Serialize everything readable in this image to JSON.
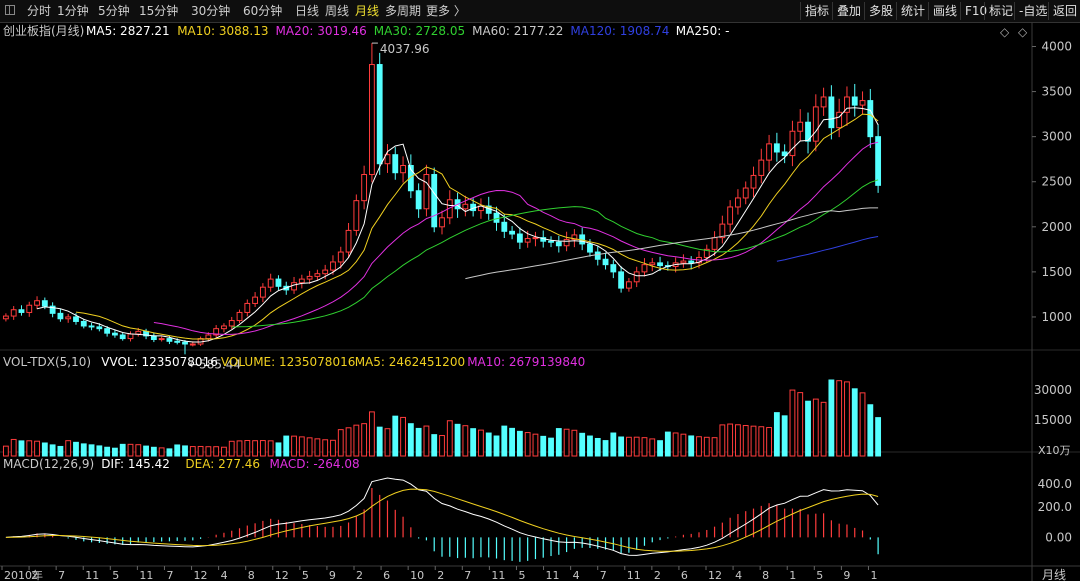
{
  "toolbar": {
    "periods": [
      "分时",
      "1分钟",
      "5分钟",
      "15分钟",
      "30分钟",
      "60分钟",
      "日线",
      "周线",
      "月线",
      "多周期",
      "更多 〉"
    ],
    "active_period": "月线",
    "right_buttons": [
      "指标",
      "叠加",
      "多股",
      "统计",
      "画线",
      "F10",
      "标记",
      "-自选",
      "返回"
    ]
  },
  "price_panel": {
    "title": "创业板指(月线)",
    "ma_items": [
      {
        "text": "MA5: 2827.21",
        "color": "#ffffff"
      },
      {
        "text": "MA10: 3088.13",
        "color": "#f0d020"
      },
      {
        "text": "MA20: 3019.46",
        "color": "#e030e0"
      },
      {
        "text": "MA30: 2728.05",
        "color": "#30d030"
      },
      {
        "text": "MA60: 2177.22",
        "color": "#c8c8c8"
      },
      {
        "text": "MA120: 1908.74",
        "color": "#3040e0"
      },
      {
        "text": "MA250: -",
        "color": "#ffffff"
      }
    ],
    "high_label": "4037.96",
    "low_label": "585.44",
    "yticks": [
      1000,
      1500,
      2000,
      2500,
      3000,
      3500,
      4000
    ]
  },
  "volume_panel": {
    "items": [
      {
        "text": "VOL-TDX(5,10)",
        "color": "#c8c8c8"
      },
      {
        "text": "VVOL: 1235078016",
        "color": "#ffffff"
      },
      {
        "text": "VOLUME: 1235078016",
        "color": "#f0d020"
      },
      {
        "text": "MA5: 2462451200",
        "color": "#f0d020"
      },
      {
        "text": "MA10: 2679139840",
        "color": "#e030e0"
      }
    ],
    "yticks": [
      "30000",
      "15000"
    ],
    "unit": "X10万"
  },
  "macd_panel": {
    "items": [
      {
        "text": "MACD(12,26,9)",
        "color": "#c8c8c8"
      },
      {
        "text": "DIF: 145.42",
        "color": "#ffffff"
      },
      {
        "text": "DEA: 277.46",
        "color": "#f0d020"
      },
      {
        "text": "MACD: -264.08",
        "color": "#e030e0"
      }
    ],
    "yticks": [
      "400.0",
      "200.0",
      "0.00"
    ]
  },
  "xaxis": {
    "labels": [
      "2010年",
      "2",
      "7",
      "11",
      "5",
      "11",
      "7",
      "12",
      "4",
      "8",
      "12",
      "5",
      "9",
      "2",
      "6",
      "10",
      "2",
      "7",
      "11",
      "5",
      "11",
      "4",
      "7",
      "11",
      "2",
      "6",
      "12",
      "4",
      "8",
      "1",
      "5",
      "9",
      "1"
    ],
    "period_label": "月线"
  },
  "chart_data": {
    "type": "candlestick",
    "title": "创业板指(月线)",
    "high": 4037.96,
    "low": 585.44,
    "ylim": [
      700,
      4050
    ],
    "closes": [
      1010,
      1080,
      1050,
      1130,
      1180,
      1120,
      1040,
      980,
      1000,
      950,
      900,
      890,
      870,
      820,
      800,
      760,
      810,
      840,
      790,
      750,
      760,
      730,
      720,
      700,
      700,
      760,
      800,
      870,
      900,
      960,
      1050,
      1150,
      1220,
      1330,
      1420,
      1340,
      1300,
      1380,
      1420,
      1450,
      1480,
      1520,
      1610,
      1720,
      1960,
      2290,
      2580,
      3800,
      2700,
      2800,
      2600,
      2680,
      2400,
      2200,
      2580,
      2000,
      2100,
      2300,
      2200,
      2250,
      2180,
      2230,
      2150,
      2050,
      1950,
      1920,
      1830,
      1870,
      1880,
      1840,
      1830,
      1790,
      1860,
      1910,
      1810,
      1720,
      1640,
      1580,
      1500,
      1320,
      1390,
      1500,
      1580,
      1600,
      1570,
      1560,
      1600,
      1620,
      1600,
      1660,
      1750,
      1880,
      2030,
      2220,
      2320,
      2430,
      2570,
      2740,
      2920,
      2830,
      2790,
      3060,
      3160,
      2950,
      3330,
      3440,
      3100,
      3270,
      3440,
      3350,
      3400,
      3000,
      2460
    ]
  }
}
